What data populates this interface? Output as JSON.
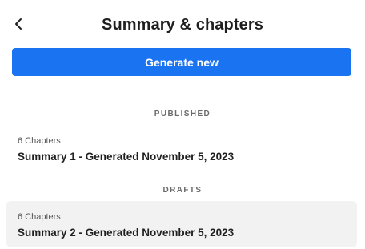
{
  "header": {
    "title": "Summary & chapters",
    "back_icon": "chevron-left-icon"
  },
  "actions": {
    "generate_label": "Generate new",
    "accent_color": "#1a73f1"
  },
  "sections": {
    "published": {
      "heading": "PUBLISHED",
      "items": [
        {
          "meta": "6 Chapters",
          "title": "Summary 1 - Generated November 5, 2023"
        }
      ]
    },
    "drafts": {
      "heading": "DRAFTS",
      "items": [
        {
          "meta": "6 Chapters",
          "title": "Summary 2 - Generated November 5, 2023"
        }
      ]
    }
  }
}
